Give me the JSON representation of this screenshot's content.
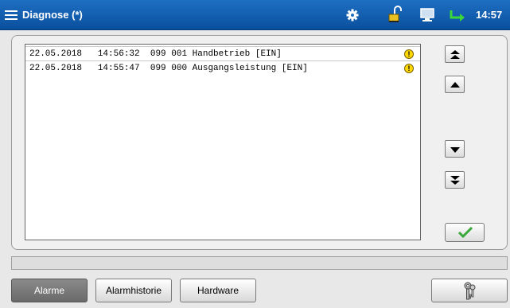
{
  "header": {
    "title": "Diagnose (*)",
    "time": "14:57",
    "icons": [
      "menu-icon",
      "gear-icon",
      "lock-icon",
      "monitor-icon",
      "arrow-icon"
    ]
  },
  "alarms": [
    {
      "date": "22.05.2018",
      "time": "14:56:32",
      "text": "099 001 Handbetrieb [EIN]"
    },
    {
      "date": "22.05.2018",
      "time": "14:55:47",
      "text": "099 000 Ausgangsleistung [EIN]"
    }
  ],
  "tabs": {
    "alarme": "Alarme",
    "alarmhistorie": "Alarmhistorie",
    "hardware": "Hardware"
  },
  "colors": {
    "header": "#1e6fc2",
    "warning": "#ffd800",
    "check": "#3aa83a"
  }
}
